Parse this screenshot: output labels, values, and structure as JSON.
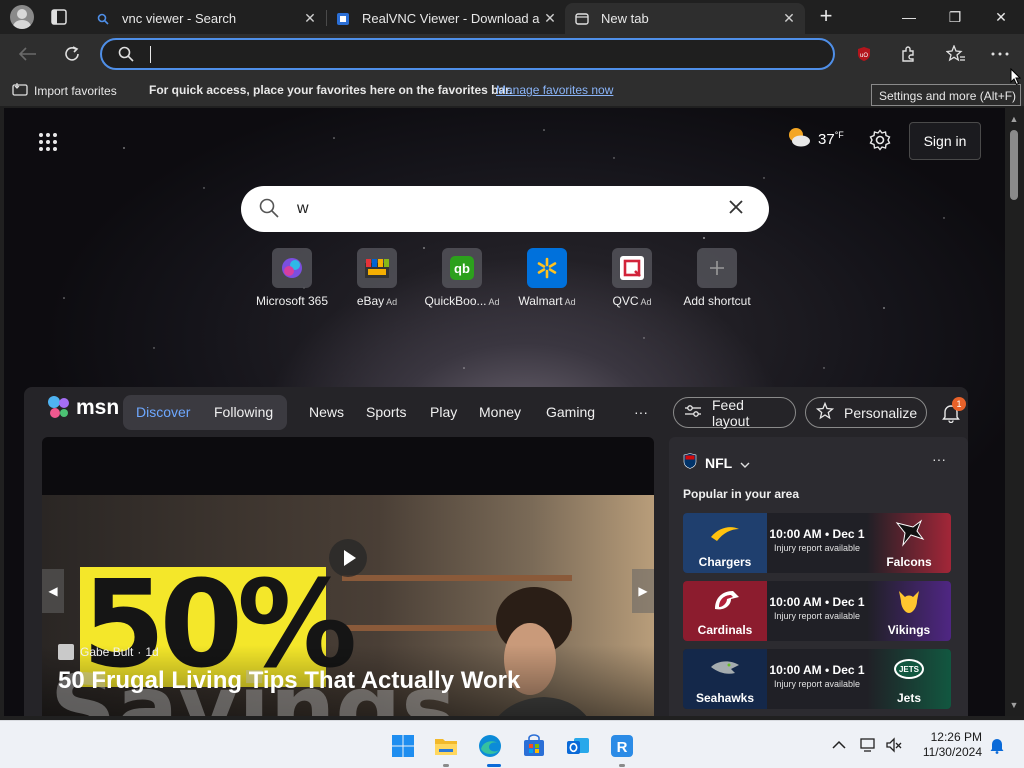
{
  "browser": {
    "tabs": [
      {
        "title": "vnc viewer - Search",
        "close": "✕",
        "active": false
      },
      {
        "title": "RealVNC Viewer - Download and",
        "close": "✕",
        "active": false
      },
      {
        "title": "New tab",
        "close": "✕",
        "active": true
      }
    ],
    "new_tab_label": "+",
    "window_buttons": {
      "minimize": "—",
      "maximize": "❐",
      "close": "✕"
    },
    "address_bar": {
      "value": "",
      "placeholder": ""
    },
    "favorites_bar": {
      "import_label": "Import favorites",
      "message": "For quick access, place your favorites here on the favorites bar.",
      "manage_link": "Manage favorites now"
    },
    "tooltip": "Settings and more (Alt+F)",
    "colors": {
      "accent": "#4f8fe8",
      "link": "#8ab4f8"
    }
  },
  "newtab": {
    "weather": {
      "temp": "37",
      "unit": "°F"
    },
    "sign_in_label": "Sign in",
    "search": {
      "value": "w"
    },
    "shortcuts": [
      {
        "label": "Microsoft 365",
        "ad": ""
      },
      {
        "label": "eBay",
        "ad": "Ad"
      },
      {
        "label": "QuickBoo...",
        "ad": "Ad"
      },
      {
        "label": "Walmart",
        "ad": "Ad"
      },
      {
        "label": "QVC",
        "ad": "Ad"
      },
      {
        "label": "Add shortcut",
        "ad": ""
      }
    ]
  },
  "feed": {
    "brand": "msn",
    "tabs": {
      "discover": "Discover",
      "following": "Following"
    },
    "nav": [
      "News",
      "Sports",
      "Play",
      "Money",
      "Gaming"
    ],
    "more": "···",
    "feed_layout_label": "Feed layout",
    "personalize_label": "Personalize",
    "notification_count": "1",
    "hero": {
      "image_text": "50%",
      "image_text2": "Savings",
      "author": "Gabe Bult",
      "age": "1d",
      "headline": "50 Frugal Living Tips That Actually Work"
    },
    "nfl": {
      "title": "NFL",
      "more": "···",
      "subtitle": "Popular in your area",
      "games": [
        {
          "home": "Chargers",
          "away": "Falcons",
          "time": "10:00 AM • Dec 1",
          "note": "Injury report available",
          "home_color": "#1f3f6e",
          "away_color": "#a32638"
        },
        {
          "home": "Cardinals",
          "away": "Vikings",
          "time": "10:00 AM • Dec 1",
          "note": "Injury report available",
          "home_color": "#8c1c2e",
          "away_color": "#4f2683"
        },
        {
          "home": "Seahawks",
          "away": "Jets",
          "time": "10:00 AM • Dec 1",
          "note": "Injury report available",
          "home_color": "#14284a",
          "away_color": "#125740"
        }
      ]
    }
  },
  "taskbar": {
    "time": "12:26 PM",
    "date": "11/30/2024"
  }
}
